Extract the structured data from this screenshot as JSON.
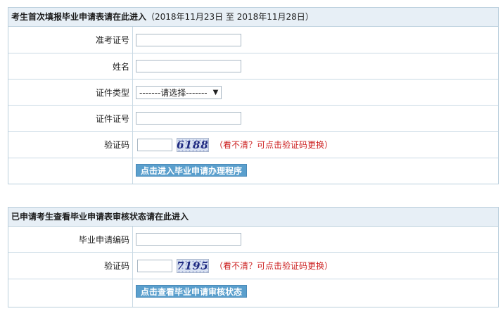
{
  "section1": {
    "title": "考生首次填报毕业申请表请在此进入",
    "subtitle": "（2018年11月23日 至 2018年11月28日）",
    "fields": {
      "exam_no_label": "准考证号",
      "exam_no_value": "",
      "name_label": "姓名",
      "name_value": "",
      "id_type_label": "证件类型",
      "id_type_selected": "-------请选择-------",
      "id_no_label": "证件证号",
      "id_no_value": "",
      "captcha_label": "验证码",
      "captcha_value": "",
      "captcha_code": "6188",
      "captcha_hint": "（看不清？可点击验证码更换）"
    },
    "submit_label": "点击进入毕业申请办理程序"
  },
  "section2": {
    "title": "已申请考生查看毕业申请表审核状态请在此进入",
    "fields": {
      "app_no_label": "毕业申请编码",
      "app_no_value": "",
      "captcha_label": "验证码",
      "captcha_value": "",
      "captcha_code": "7195",
      "captcha_hint": "（看不清？可点击验证码更换）"
    },
    "submit_label": "点击查看毕业申请审核状态"
  },
  "colors": {
    "header_bg": "#e7eff6",
    "border": "#b9cedc",
    "button_bg": "#5a9fcd",
    "hint_red": "#cc1f1f"
  },
  "icons": {
    "dropdown": "dropdown-arrow-icon"
  }
}
